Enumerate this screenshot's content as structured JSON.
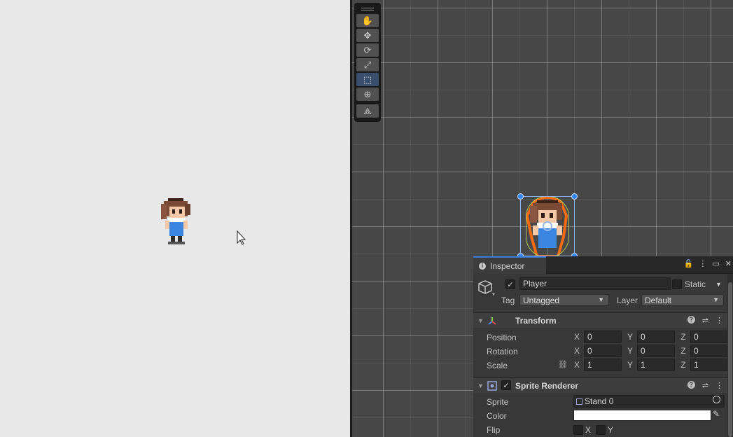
{
  "scene": {
    "tools": [
      {
        "name": "hand-tool",
        "glyph": "✋"
      },
      {
        "name": "move-tool",
        "glyph": "✥"
      },
      {
        "name": "rotate-tool",
        "glyph": "⟳"
      },
      {
        "name": "scale-tool",
        "glyph": "⤢"
      },
      {
        "name": "rect-tool",
        "glyph": "⬚"
      },
      {
        "name": "transform-tool",
        "glyph": "⊕"
      },
      {
        "name": "custom-tool",
        "glyph": "⟁"
      }
    ],
    "active_tool": "rect-tool"
  },
  "inspector": {
    "tab_label": "Inspector",
    "object": {
      "active": true,
      "name": "Player",
      "static_label": "Static",
      "tag_label": "Tag",
      "tag_value": "Untagged",
      "layer_label": "Layer",
      "layer_value": "Default"
    },
    "transform": {
      "title": "Transform",
      "rows": [
        {
          "label": "Position",
          "x": "0",
          "y": "0",
          "z": "0"
        },
        {
          "label": "Rotation",
          "x": "0",
          "y": "0",
          "z": "0"
        },
        {
          "label": "Scale",
          "x": "1",
          "y": "1",
          "z": "1"
        }
      ]
    },
    "sprite_renderer": {
      "enabled": true,
      "title": "Sprite Renderer",
      "sprite_label": "Sprite",
      "sprite_value": "Stand 0",
      "color_label": "Color",
      "color_value": "#ffffff",
      "flip_label": "Flip",
      "flip_x": "X",
      "flip_y": "Y"
    }
  },
  "axes": {
    "x": "X",
    "y": "Y",
    "z": "Z"
  }
}
